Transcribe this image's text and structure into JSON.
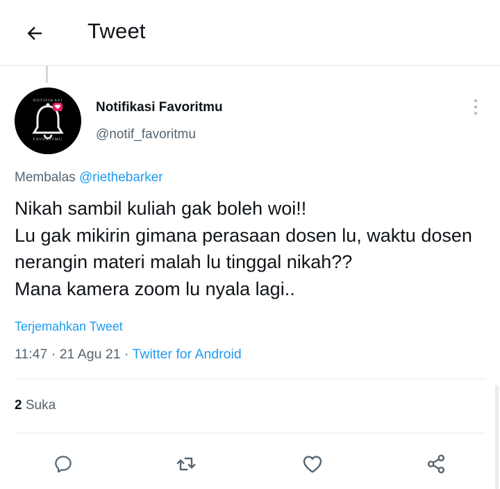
{
  "header": {
    "title": "Tweet",
    "back_icon": "arrow-left-icon"
  },
  "author": {
    "display_name": "Notifikasi Favoritmu",
    "handle": "@notif_favoritmu",
    "avatar_text_top": "NOTIFIKASI",
    "avatar_text_bottom": "FAVORITMU",
    "avatar_icon": "bell-icon"
  },
  "reply": {
    "prefix": "Membalas",
    "mention": "@riethebarker"
  },
  "tweet": {
    "text": "Nikah sambil kuliah gak boleh woi!!\nLu gak mikirin gimana perasaan dosen lu, waktu dosen nerangin materi malah lu tinggal nikah??\nMana kamera zoom lu nyala lagi..",
    "translate_label": "Terjemahkan Tweet",
    "time": "11:47",
    "separator": "·",
    "date": "21 Agu 21",
    "source": "Twitter for Android"
  },
  "stats": {
    "likes_count": "2",
    "likes_label": "Suka"
  },
  "actions": [
    {
      "icon": "reply-icon"
    },
    {
      "icon": "retweet-icon"
    },
    {
      "icon": "like-icon"
    },
    {
      "icon": "share-icon"
    }
  ],
  "colors": {
    "accent": "#1d9bf0",
    "text": "#0f1419",
    "secondary": "#536471",
    "notification_badge": "#e0245e"
  }
}
